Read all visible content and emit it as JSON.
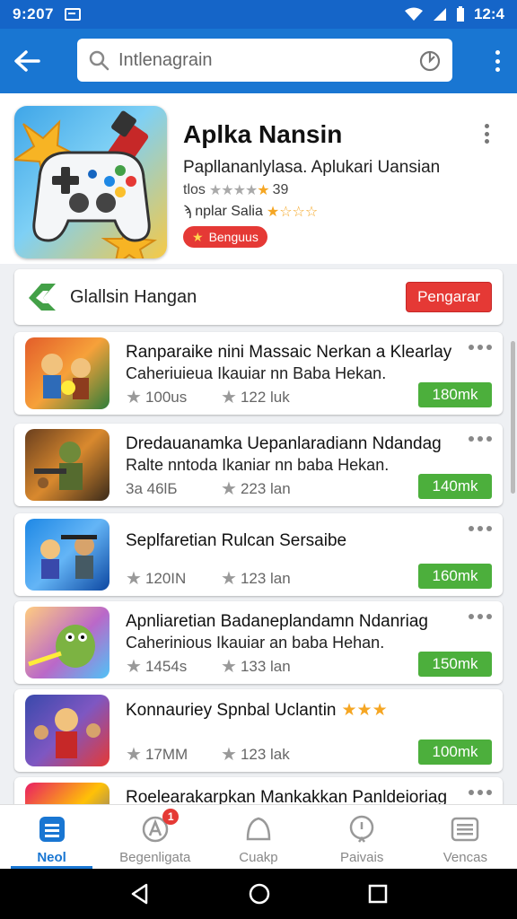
{
  "status_bar": {
    "time_left": "9:207",
    "time_right": "12:4"
  },
  "search": {
    "placeholder": "Intlenagrain"
  },
  "featured": {
    "title": "Aplka Nansin",
    "subtitle": "Papllananlylasa. Aplukari Uansian",
    "rating_prefix": "tlos",
    "rating_value": "39",
    "seller": "nplar Salia",
    "badge": "Benguus"
  },
  "promo": {
    "label": "Glallsin Hangan",
    "button": "Pengarar"
  },
  "apps": [
    {
      "title": "Ranparaike nini  Massaic Nerkan a Klearlay",
      "desc": "Caheriuieua Ikauiar nn Baba Hekan.",
      "stat1": "100us",
      "stat2": "122 luk",
      "price": "180mk"
    },
    {
      "title": "Dredauanamka Uepanlaradiann Ndandag",
      "desc": "Ralte nntoda Ikaniar nn baba Hekan.",
      "stat1": "3a 46lБ",
      "stat2": "223 lan",
      "price": "140mk"
    },
    {
      "title": "Seplfaretian Rulcan Sersaibe",
      "desc": "",
      "stat1": "120IN",
      "stat2": "123 lan",
      "price": "160mk"
    },
    {
      "title": "Apnliaretian Badaneplandamn Ndanriag",
      "desc": "Caherinious Ikauiar an baba Hehan.",
      "stat1": "1454s",
      "stat2": "133 lan",
      "price": "150mk"
    },
    {
      "title": "Konnauriey  Spnbal Uclantin",
      "desc": "",
      "stat1": "17MM",
      "stat2": "123 lak",
      "price": "100mk"
    },
    {
      "title": "Roelearakarpkan Mankakkan Panldeioriag",
      "desc": "",
      "stat1": "",
      "stat2": "",
      "price": ""
    }
  ],
  "bottom_nav": [
    {
      "label": "Neol",
      "icon": "list-icon"
    },
    {
      "label": "Begenligata",
      "icon": "tag-icon",
      "badge": "1"
    },
    {
      "label": "Cuakp",
      "icon": "home-icon"
    },
    {
      "label": "Paivais",
      "icon": "chat-icon"
    },
    {
      "label": "Vencas",
      "icon": "menu-icon"
    }
  ],
  "colors": {
    "primary": "#1976d2",
    "green": "#4caf3c",
    "red": "#e53935"
  }
}
